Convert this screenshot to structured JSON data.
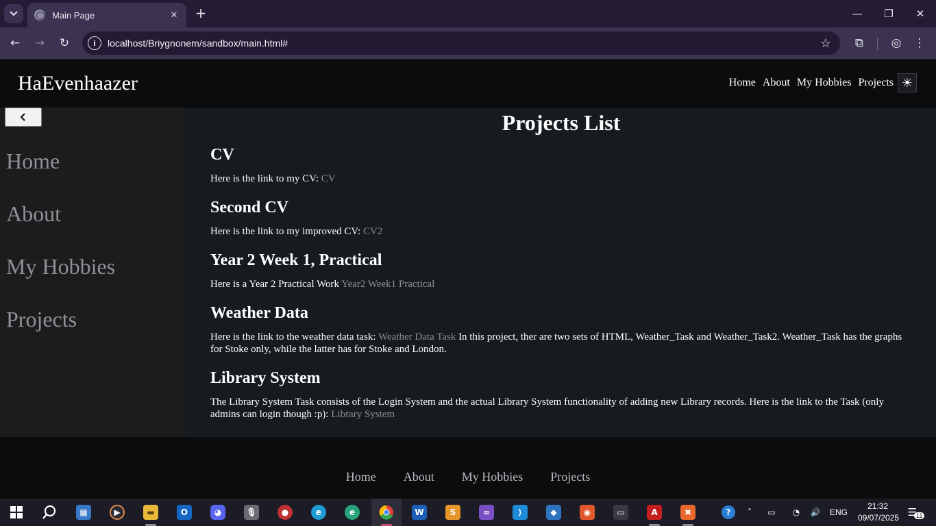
{
  "browser": {
    "tab_title": "Main Page",
    "url": "localhost/Briygnonem/sandbox/main.html#",
    "icons": [
      "tab-search-icon",
      "favicon-icon",
      "close-icon",
      "plus-icon",
      "minimize-icon",
      "restore-icon",
      "close-window-icon",
      "back-icon",
      "forward-icon",
      "reload-icon",
      "site-info-icon",
      "star-icon",
      "extensions-icon",
      "profile-icon",
      "menu-icon"
    ]
  },
  "header": {
    "brand": "HaEvenhaazer",
    "nav": [
      "Home",
      "About",
      "My Hobbies",
      "Projects"
    ],
    "theme_icon": "sun-icon"
  },
  "sidebar": {
    "collapse_icon": "chevron-left-icon",
    "items": [
      "Home",
      "About",
      "My Hobbies",
      "Projects"
    ]
  },
  "main": {
    "title": "Projects List",
    "projects": [
      {
        "heading": "CV",
        "text": "Here is the link to my CV: ",
        "link": "CV",
        "after": ""
      },
      {
        "heading": "Second CV",
        "text": "Here is the link to my improved CV: ",
        "link": "CV2",
        "after": ""
      },
      {
        "heading": "Year 2 Week 1, Practical",
        "text": "Here is a Year 2 Practical Work ",
        "link": "Year2 Week1 Practical",
        "after": ""
      },
      {
        "heading": "Weather Data",
        "text": "Here is the link to the weather data task: ",
        "link": "Weather Data Task",
        "after": " In this project, ther are two sets of HTML, Weather_Task and Weather_Task2. Weather_Task has the graphs for Stoke only, while the latter has for Stoke and London."
      },
      {
        "heading": "Library System",
        "text": "The Library System Task consists of the Login System and the actual Library System functionality of adding new Library records. Here is the link to the Task (only admins can login though :p): ",
        "link": "Library System",
        "after": ""
      }
    ]
  },
  "footer": {
    "nav": [
      "Home",
      "About",
      "My Hobbies",
      "Projects"
    ]
  },
  "taskbar": {
    "apps": [
      "windows-start-icon",
      "search-icon",
      "media-app-icon",
      "media-player-icon",
      "file-explorer-icon",
      "outlook-icon",
      "discord-icon",
      "microphone-app-icon",
      "app-icon",
      "edge-icon",
      "edge-beta-icon",
      "chrome-icon",
      "word-icon",
      "sublime-text-icon",
      "visual-studio-icon",
      "vscode-icon",
      "virtualbox-icon",
      "ubuntu-icon",
      "wsl-icon",
      "acrobat-icon",
      "xampp-icon"
    ],
    "language": "ENG",
    "time": "21:32",
    "date": "09/07/2025",
    "notification_count": "11"
  }
}
